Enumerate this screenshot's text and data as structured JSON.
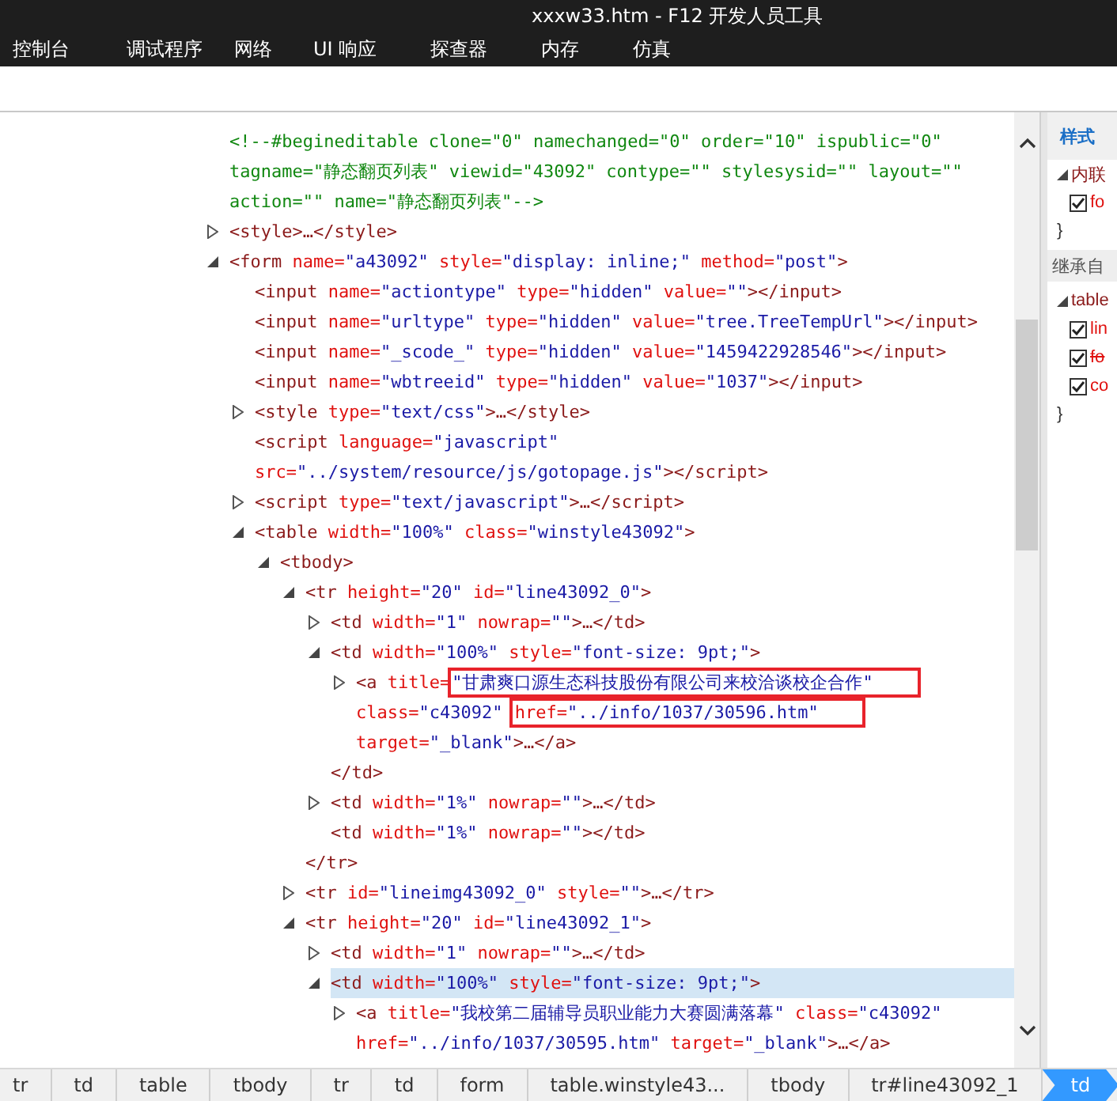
{
  "window": {
    "title": "xxxw33.htm - F12 开发人员工具"
  },
  "tabs": [
    {
      "label": "控制台",
      "selected": false
    },
    {
      "label": "调试程序",
      "selected": false
    },
    {
      "label": "网络",
      "selected": false
    },
    {
      "label": "UI 响应",
      "selected": false
    },
    {
      "label": "探查器",
      "selected": false
    },
    {
      "label": "内存",
      "selected": false
    },
    {
      "label": "仿真",
      "selected": false
    }
  ],
  "dom_tree": [
    {
      "lines": [
        [
          {
            "kind": "comment",
            "text": "<!--#begineditable clone=\"0\" namechanged=\"0\" order=\"10\" ispublic=\"0\""
          }
        ],
        [
          {
            "kind": "comment",
            "text": "tagname=\"静态翻页列表\" viewid=\"43092\" contype=\"\" stylesysid=\"\" layout=\"\""
          }
        ],
        [
          {
            "kind": "comment",
            "text": "action=\"\" name=\"静态翻页列表\"-->"
          }
        ]
      ]
    },
    {
      "expanded": false,
      "lines": [
        [
          {
            "kind": "tag",
            "text": "<style>…</style>"
          }
        ]
      ]
    },
    {
      "expanded": true,
      "lines": [
        [
          {
            "kind": "tag",
            "text": "<form"
          },
          {
            "kind": "attr",
            "name": "name=",
            "value": "\"a43092\""
          },
          {
            "kind": "attr",
            "name": "style=",
            "value": "\"display: inline;\""
          },
          {
            "kind": "attr",
            "name": "method=",
            "value": "\"post\""
          },
          {
            "kind": "tag",
            "text": ">"
          }
        ]
      ],
      "children": [
        {
          "lines": [
            [
              {
                "kind": "tag",
                "text": "<input"
              },
              {
                "kind": "attr",
                "name": "name=",
                "value": "\"actiontype\""
              },
              {
                "kind": "attr",
                "name": "type=",
                "value": "\"hidden\""
              },
              {
                "kind": "attr",
                "name": "value=",
                "value": "\"\""
              },
              {
                "kind": "tag",
                "text": "></input>"
              }
            ]
          ]
        },
        {
          "lines": [
            [
              {
                "kind": "tag",
                "text": "<input"
              },
              {
                "kind": "attr",
                "name": "name=",
                "value": "\"urltype\""
              },
              {
                "kind": "attr",
                "name": "type=",
                "value": "\"hidden\""
              },
              {
                "kind": "attr",
                "name": "value=",
                "value": "\"tree.TreeTempUrl\""
              },
              {
                "kind": "tag",
                "text": "></input>"
              }
            ]
          ]
        },
        {
          "lines": [
            [
              {
                "kind": "tag",
                "text": "<input"
              },
              {
                "kind": "attr",
                "name": "name=",
                "value": "\"_scode_\""
              },
              {
                "kind": "attr",
                "name": "type=",
                "value": "\"hidden\""
              },
              {
                "kind": "attr",
                "name": "value=",
                "value": "\"1459422928546\""
              },
              {
                "kind": "tag",
                "text": "></input>"
              }
            ]
          ]
        },
        {
          "lines": [
            [
              {
                "kind": "tag",
                "text": "<input"
              },
              {
                "kind": "attr",
                "name": "name=",
                "value": "\"wbtreeid\""
              },
              {
                "kind": "attr",
                "name": "type=",
                "value": "\"hidden\""
              },
              {
                "kind": "attr",
                "name": "value=",
                "value": "\"1037\""
              },
              {
                "kind": "tag",
                "text": "></input>"
              }
            ]
          ]
        },
        {
          "expanded": false,
          "lines": [
            [
              {
                "kind": "tag",
                "text": "<style"
              },
              {
                "kind": "attr",
                "name": "type=",
                "value": "\"text/css\""
              },
              {
                "kind": "tag",
                "text": ">…</style>"
              }
            ]
          ]
        },
        {
          "lines": [
            [
              {
                "kind": "tag",
                "text": "<script"
              },
              {
                "kind": "attr",
                "name": "language=",
                "value": "\"javascript\""
              }
            ],
            [
              {
                "kind": "attr",
                "name": "src=",
                "value": "\"../system/resource/js/gotopage.js\""
              },
              {
                "kind": "tag",
                "text": "></script>"
              }
            ]
          ]
        },
        {
          "expanded": false,
          "lines": [
            [
              {
                "kind": "tag",
                "text": "<script"
              },
              {
                "kind": "attr",
                "name": "type=",
                "value": "\"text/javascript\""
              },
              {
                "kind": "tag",
                "text": ">…</script>"
              }
            ]
          ]
        },
        {
          "expanded": true,
          "lines": [
            [
              {
                "kind": "tag",
                "text": "<table"
              },
              {
                "kind": "attr",
                "name": "width=",
                "value": "\"100%\""
              },
              {
                "kind": "attr",
                "name": "class=",
                "value": "\"winstyle43092\""
              },
              {
                "kind": "tag",
                "text": ">"
              }
            ]
          ],
          "children": [
            {
              "expanded": true,
              "lines": [
                [
                  {
                    "kind": "tag",
                    "text": "<tbody>"
                  }
                ]
              ],
              "children": [
                {
                  "expanded": true,
                  "lines": [
                    [
                      {
                        "kind": "tag",
                        "text": "<tr"
                      },
                      {
                        "kind": "attr",
                        "name": "height=",
                        "value": "\"20\""
                      },
                      {
                        "kind": "attr",
                        "name": "id=",
                        "value": "\"line43092_0\""
                      },
                      {
                        "kind": "tag",
                        "text": ">"
                      }
                    ]
                  ],
                  "children": [
                    {
                      "expanded": false,
                      "lines": [
                        [
                          {
                            "kind": "tag",
                            "text": "<td"
                          },
                          {
                            "kind": "attr",
                            "name": "width=",
                            "value": "\"1\""
                          },
                          {
                            "kind": "attr",
                            "name": "nowrap=",
                            "value": "\"\""
                          },
                          {
                            "kind": "tag",
                            "text": ">…</td>"
                          }
                        ]
                      ]
                    },
                    {
                      "expanded": true,
                      "lines": [
                        [
                          {
                            "kind": "tag",
                            "text": "<td"
                          },
                          {
                            "kind": "attr",
                            "name": "width=",
                            "value": "\"100%\""
                          },
                          {
                            "kind": "attr",
                            "name": "style=",
                            "value": "\"font-size: 9pt;\""
                          },
                          {
                            "kind": "tag",
                            "text": ">"
                          }
                        ]
                      ],
                      "children": [
                        {
                          "expanded": false,
                          "lines": [
                            [
                              {
                                "kind": "tag",
                                "text": "<a"
                              },
                              {
                                "kind": "attr",
                                "name": "title=",
                                "value": "\"甘肃爽口源生态科技股份有限公司来校洽谈校企合作\"",
                                "value_boxed": true
                              }
                            ],
                            [
                              {
                                "kind": "attr",
                                "name": "class=",
                                "value": "\"c43092\""
                              },
                              {
                                "kind": "attr",
                                "name": "href=",
                                "value": "\"../info/1037/30596.htm\"",
                                "attribute_boxed": true
                              }
                            ],
                            [
                              {
                                "kind": "attr",
                                "name": "target=",
                                "value": "\"_blank\""
                              },
                              {
                                "kind": "tag",
                                "text": ">…</a>"
                              }
                            ]
                          ]
                        }
                      ]
                    },
                    {
                      "lines": [
                        [
                          {
                            "kind": "tag",
                            "text": "</td>"
                          }
                        ]
                      ]
                    },
                    {
                      "expanded": false,
                      "lines": [
                        [
                          {
                            "kind": "tag",
                            "text": "<td"
                          },
                          {
                            "kind": "attr",
                            "name": "width=",
                            "value": "\"1%\""
                          },
                          {
                            "kind": "attr",
                            "name": "nowrap=",
                            "value": "\"\""
                          },
                          {
                            "kind": "tag",
                            "text": ">…</td>"
                          }
                        ]
                      ]
                    },
                    {
                      "lines": [
                        [
                          {
                            "kind": "tag",
                            "text": "<td"
                          },
                          {
                            "kind": "attr",
                            "name": "width=",
                            "value": "\"1%\""
                          },
                          {
                            "kind": "attr",
                            "name": "nowrap=",
                            "value": "\"\""
                          },
                          {
                            "kind": "tag",
                            "text": "></td>"
                          }
                        ]
                      ]
                    }
                  ]
                },
                {
                  "lines": [
                    [
                      {
                        "kind": "tag",
                        "text": "</tr>"
                      }
                    ]
                  ]
                },
                {
                  "expanded": false,
                  "lines": [
                    [
                      {
                        "kind": "tag",
                        "text": "<tr"
                      },
                      {
                        "kind": "attr",
                        "name": "id=",
                        "value": "\"lineimg43092_0\""
                      },
                      {
                        "kind": "attr",
                        "name": "style=",
                        "value": "\"\""
                      },
                      {
                        "kind": "tag",
                        "text": ">…</tr>"
                      }
                    ]
                  ]
                },
                {
                  "expanded": true,
                  "lines": [
                    [
                      {
                        "kind": "tag",
                        "text": "<tr"
                      },
                      {
                        "kind": "attr",
                        "name": "height=",
                        "value": "\"20\""
                      },
                      {
                        "kind": "attr",
                        "name": "id=",
                        "value": "\"line43092_1\""
                      },
                      {
                        "kind": "tag",
                        "text": ">"
                      }
                    ]
                  ],
                  "children": [
                    {
                      "expanded": false,
                      "lines": [
                        [
                          {
                            "kind": "tag",
                            "text": "<td"
                          },
                          {
                            "kind": "attr",
                            "name": "width=",
                            "value": "\"1\""
                          },
                          {
                            "kind": "attr",
                            "name": "nowrap=",
                            "value": "\"\""
                          },
                          {
                            "kind": "tag",
                            "text": ">…</td>"
                          }
                        ]
                      ]
                    },
                    {
                      "expanded": true,
                      "selected": true,
                      "lines": [
                        [
                          {
                            "kind": "tag",
                            "text": "<td"
                          },
                          {
                            "kind": "attr",
                            "name": "width=",
                            "value": "\"100%\""
                          },
                          {
                            "kind": "attr",
                            "name": "style=",
                            "value": "\"font-size: 9pt;\""
                          },
                          {
                            "kind": "tag",
                            "text": ">"
                          }
                        ]
                      ],
                      "children": [
                        {
                          "expanded": false,
                          "lines": [
                            [
                              {
                                "kind": "tag",
                                "text": "<a"
                              },
                              {
                                "kind": "attr",
                                "name": "title=",
                                "value": "\"我校第二届辅导员职业能力大赛圆满落幕\""
                              },
                              {
                                "kind": "attr",
                                "name": "class=",
                                "value": "\"c43092\""
                              }
                            ],
                            [
                              {
                                "kind": "attr",
                                "name": "href=",
                                "value": "\"../info/1037/30595.htm\""
                              },
                              {
                                "kind": "attr",
                                "name": "target=",
                                "value": "\"_blank\""
                              },
                              {
                                "kind": "tag",
                                "text": ">…</a>"
                              }
                            ]
                          ]
                        }
                      ]
                    }
                  ]
                }
              ]
            }
          ]
        }
      ]
    }
  ],
  "styles_panel": {
    "title": "样式",
    "rules": [
      {
        "kind": "group",
        "text": "内联"
      },
      {
        "kind": "property",
        "text": "fo",
        "checked": true,
        "overridden": false
      },
      {
        "kind": "brace",
        "text": "}"
      },
      {
        "kind": "heading",
        "text": "继承自"
      },
      {
        "kind": "group",
        "text": "table"
      },
      {
        "kind": "property",
        "text": "lin",
        "checked": true,
        "overridden": false
      },
      {
        "kind": "property",
        "text": "fo",
        "checked": true,
        "overridden": true
      },
      {
        "kind": "property",
        "text": "co",
        "checked": true,
        "overridden": false
      },
      {
        "kind": "brace",
        "text": "}"
      }
    ]
  },
  "breadcrumb": [
    {
      "label": "tr",
      "selected": false
    },
    {
      "label": "td",
      "selected": false
    },
    {
      "label": "table",
      "selected": false
    },
    {
      "label": "tbody",
      "selected": false
    },
    {
      "label": "tr",
      "selected": false
    },
    {
      "label": "td",
      "selected": false
    },
    {
      "label": "form",
      "selected": false
    },
    {
      "label": "table.winstyle43...",
      "selected": false
    },
    {
      "label": "tbody",
      "selected": false
    },
    {
      "label": "tr#line43092_1",
      "selected": false
    },
    {
      "label": "td",
      "selected": true
    }
  ]
}
